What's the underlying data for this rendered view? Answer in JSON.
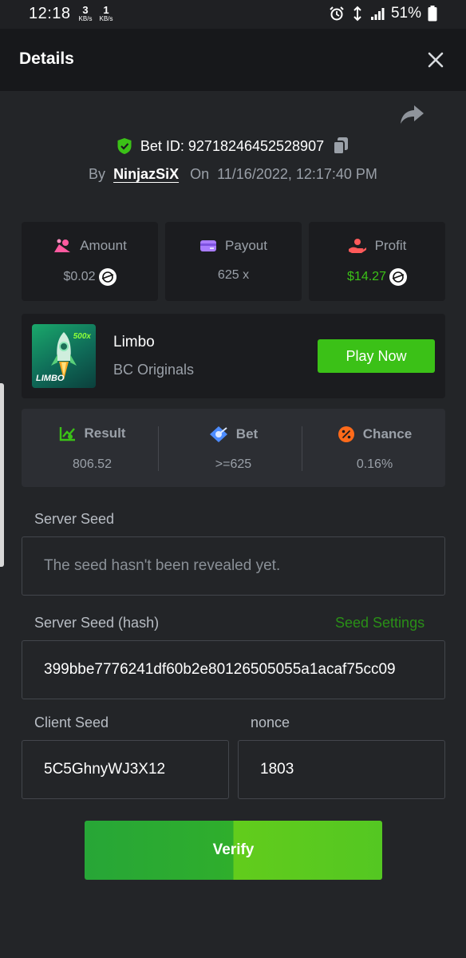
{
  "status_bar": {
    "time": "12:18",
    "net_down": {
      "value": "3",
      "unit": "KB/s"
    },
    "net_up": {
      "value": "1",
      "unit": "KB/s"
    },
    "battery": "51%",
    "icons": [
      "alarm-icon",
      "wifi-icon",
      "signal-icon",
      "battery-icon"
    ]
  },
  "header": {
    "title": "Details",
    "close_icon": "close-icon"
  },
  "bet": {
    "id_label": "Bet ID: 92718246452528907",
    "by_label": "By",
    "username": "NinjazSiX",
    "on_label": "On",
    "date": "11/16/2022, 12:17:40 PM"
  },
  "stats": [
    {
      "label": "Amount",
      "value": "$0.02",
      "icon": "bet-amount-icon",
      "color": "#ff5aa0",
      "coin": true
    },
    {
      "label": "Payout",
      "value": "625 x",
      "icon": "card-icon",
      "color": "#a97cff",
      "coin": false
    },
    {
      "label": "Profit",
      "value": "$14.27",
      "icon": "profit-hand-icon",
      "color": "#ff5a5a",
      "coin": true
    }
  ],
  "game": {
    "name": "Limbo",
    "provider": "BC Originals",
    "thumb_label": "LIMBO",
    "thumb_mult": "500x",
    "play_label": "Play Now"
  },
  "result": [
    {
      "label": "Result",
      "value": "806.52",
      "icon": "chart-up-icon",
      "color": "#3bc117"
    },
    {
      "label": "Bet",
      "value": ">=625",
      "icon": "target-diamond-icon",
      "color": "#4d8cff"
    },
    {
      "label": "Chance",
      "value": "0.16%",
      "icon": "percent-icon",
      "color": "#ff6a1a"
    }
  ],
  "seeds": {
    "server_seed_label": "Server Seed",
    "server_seed_value": "The seed hasn't been revealed yet.",
    "server_hash_label": "Server Seed (hash)",
    "seed_settings_label": "Seed Settings",
    "server_hash_value": "399bbe7776241df60b2e80126505055a1acaf75cc09",
    "client_seed_label": "Client Seed",
    "client_seed_value": "5C5GhnyWJ3X12",
    "nonce_label": "nonce",
    "nonce_value": "1803"
  },
  "verify_label": "Verify",
  "colors": {
    "accent_green": "#3bc117",
    "background": "#232528",
    "header": "#17181b"
  }
}
